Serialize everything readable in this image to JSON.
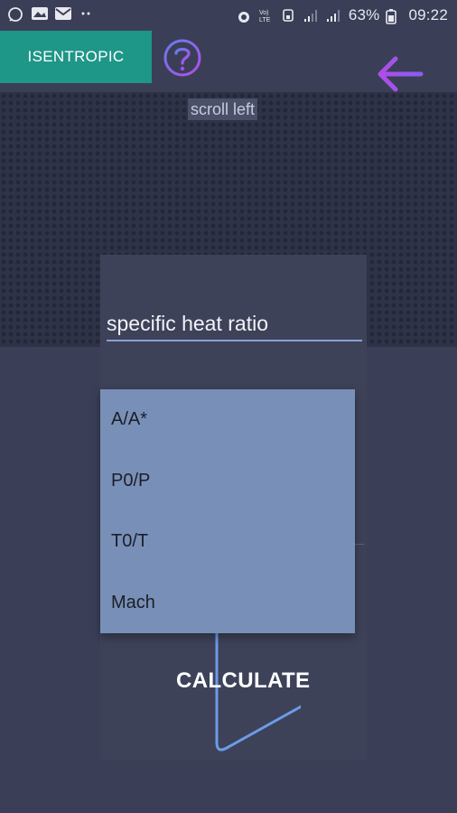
{
  "status_bar": {
    "battery": "63%",
    "time": "09:22",
    "left_icons": [
      "whatsapp-icon",
      "gallery-icon",
      "mail-icon",
      "more-dots-icon"
    ],
    "right_icons": [
      "alarm-icon",
      "volte-icon",
      "sd-icon",
      "signal-icon",
      "signal2-icon",
      "battery-icon"
    ]
  },
  "header": {
    "mode_button": "ISENTROPIC",
    "help_icon": "help-circle-icon",
    "back_icon": "back-arrow-icon"
  },
  "hint": {
    "scroll_left": "scroll left"
  },
  "form": {
    "specific_heat_placeholder": "specific heat ratio"
  },
  "dropdown": {
    "options": [
      "A/A*",
      "P0/P",
      "T0/T",
      "Mach"
    ]
  },
  "calculate": {
    "label": "CALCULATE"
  },
  "colors": {
    "background": "#3a3f57",
    "accent_teal": "#1e9688",
    "accent_purple": "#a24df0",
    "dropdown_bg": "#7890b8",
    "play_outline": "#6c9be8"
  }
}
